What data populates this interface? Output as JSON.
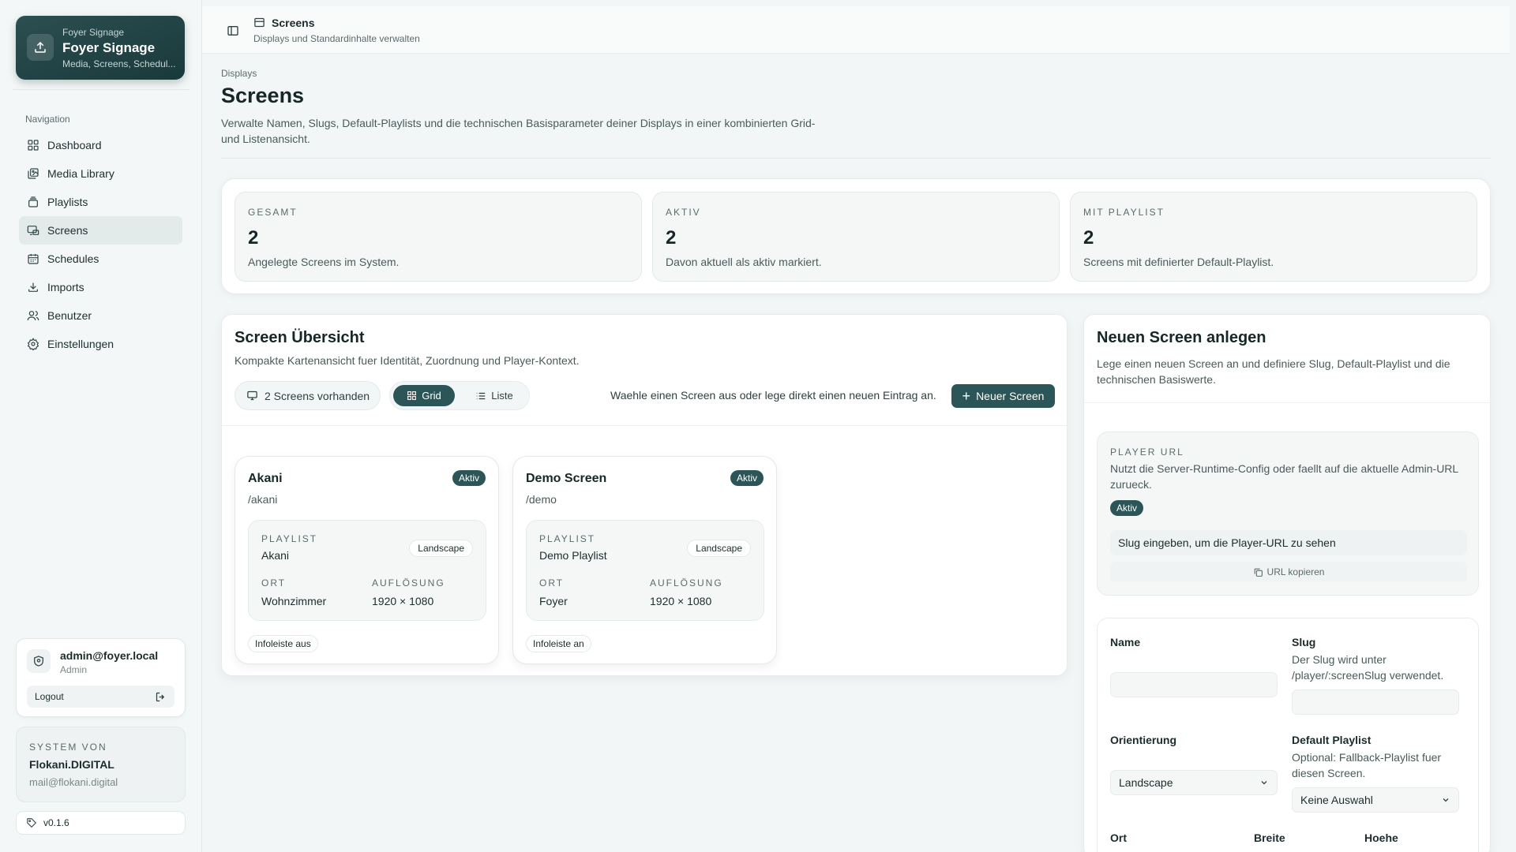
{
  "brand": {
    "pre": "Foyer Signage",
    "title": "Foyer Signage",
    "subtitle": "Media, Screens, Schedul..."
  },
  "sidebar": {
    "nav_label": "Navigation",
    "items": [
      {
        "label": "Dashboard",
        "icon": "dashboard-icon"
      },
      {
        "label": "Media Library",
        "icon": "media-library-icon"
      },
      {
        "label": "Playlists",
        "icon": "playlists-icon"
      },
      {
        "label": "Screens",
        "icon": "screens-icon",
        "active": true
      },
      {
        "label": "Schedules",
        "icon": "calendar-icon"
      },
      {
        "label": "Imports",
        "icon": "download-icon"
      },
      {
        "label": "Benutzer",
        "icon": "users-icon"
      },
      {
        "label": "Einstellungen",
        "icon": "gear-icon"
      }
    ]
  },
  "user": {
    "email": "admin@foyer.local",
    "role": "Admin",
    "logout_label": "Logout"
  },
  "system": {
    "label": "SYSTEM VON",
    "name": "Flokani.DIGITAL",
    "mail": "mail@flokani.digital"
  },
  "version": "v0.1.6",
  "header": {
    "title": "Screens",
    "subtitle": "Displays und Standardinhalte verwalten"
  },
  "page": {
    "breadcrumb": "Displays",
    "title": "Screens",
    "description": "Verwalte Namen, Slugs, Default-Playlists und die technischen Basisparameter deiner Displays in einer kombinierten Grid- und Listenansicht."
  },
  "stats": [
    {
      "label": "GESAMT",
      "value": "2",
      "desc": "Angelegte Screens im System."
    },
    {
      "label": "AKTIV",
      "value": "2",
      "desc": "Davon aktuell als aktiv markiert."
    },
    {
      "label": "MIT PLAYLIST",
      "value": "2",
      "desc": "Screens mit definierter Default-Playlist."
    }
  ],
  "overview": {
    "title": "Screen Übersicht",
    "description": "Kompakte Kartenansicht fuer Identität, Zuordnung und Player-Kontext.",
    "count_label": "2 Screens vorhanden",
    "grid_label": "Grid",
    "list_label": "Liste",
    "hint": "Waehle einen Screen aus oder lege direkt einen neuen Eintrag an.",
    "new_button": "Neuer Screen",
    "labels": {
      "playlist": "PLAYLIST",
      "ort": "ORT",
      "aufloesung": "AUFLÖSUNG"
    },
    "screens": [
      {
        "name": "Akani",
        "status": "Aktiv",
        "slug": "/akani",
        "playlist": "Akani",
        "orientation": "Landscape",
        "ort": "Wohnzimmer",
        "resolution": "1920 × 1080",
        "infobar": "Infoleiste aus"
      },
      {
        "name": "Demo Screen",
        "status": "Aktiv",
        "slug": "/demo",
        "playlist": "Demo Playlist",
        "orientation": "Landscape",
        "ort": "Foyer",
        "resolution": "1920 × 1080",
        "infobar": "Infoleiste an"
      }
    ]
  },
  "create": {
    "title": "Neuen Screen anlegen",
    "description": "Lege einen neuen Screen an und definiere Slug, Default-Playlist und die technischen Basiswerte.",
    "player": {
      "label": "PLAYER URL",
      "description": "Nutzt die Server-Runtime-Config oder faellt auf die aktuelle Admin-URL zurueck.",
      "status": "Aktiv",
      "url_placeholder": "Slug eingeben, um die Player-URL zu sehen",
      "copy_label": "URL kopieren"
    },
    "form": {
      "name_label": "Name",
      "name_value": "",
      "slug_label": "Slug",
      "slug_help": "Der Slug wird unter /player/:screenSlug verwendet.",
      "slug_value": "",
      "orientation_label": "Orientierung",
      "orientation_value": "Landscape",
      "default_playlist_label": "Default Playlist",
      "default_playlist_help": "Optional: Fallback-Playlist fuer diesen Screen.",
      "default_playlist_value": "Keine Auswahl",
      "ort_label": "Ort",
      "breite_label": "Breite",
      "hoehe_label": "Hoehe"
    }
  },
  "colors": {
    "accent": "#2c5557",
    "background": "#f3f6f6"
  }
}
